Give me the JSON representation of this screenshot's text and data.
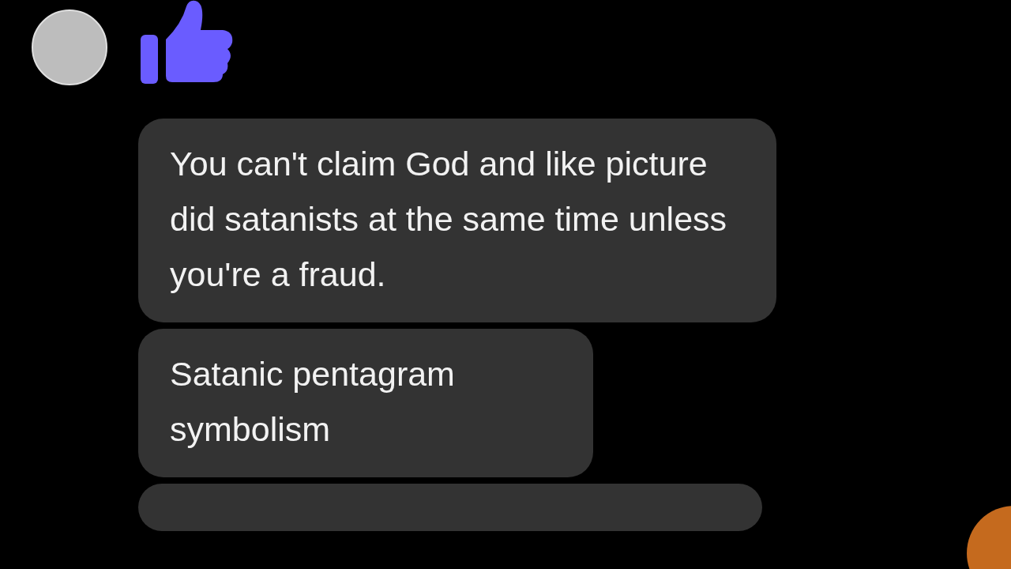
{
  "messages": [
    {
      "text": "You can't claim God and like picture did satanists at the same time unless you're a fraud."
    },
    {
      "text": "Satanic pentagram symbolism"
    }
  ]
}
